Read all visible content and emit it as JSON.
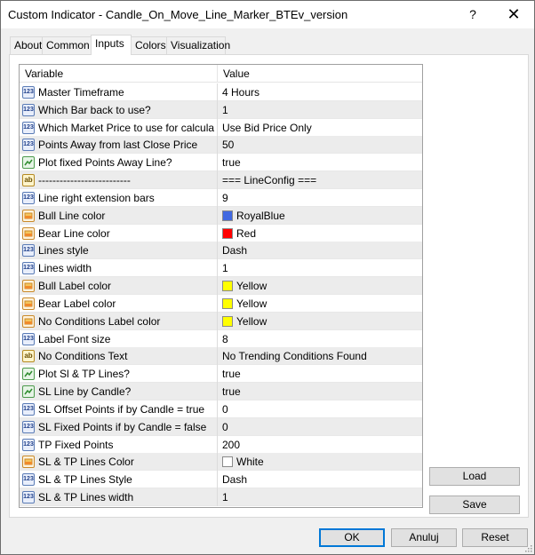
{
  "window": {
    "title": "Custom Indicator - Candle_On_Move_Line_Marker_BTEv_version",
    "help_glyph": "?",
    "close_glyph": "✕"
  },
  "tabs": [
    {
      "label": "About"
    },
    {
      "label": "Common"
    },
    {
      "label": "Inputs",
      "active": true
    },
    {
      "label": "Colors"
    },
    {
      "label": "Visualization"
    }
  ],
  "grid": {
    "col_variable": "Variable",
    "col_value": "Value",
    "rows": [
      {
        "type": "int",
        "icon": "number-icon",
        "icon_text": "123",
        "variable": "Master Timeframe",
        "value": "4 Hours"
      },
      {
        "type": "int",
        "icon": "number-icon",
        "icon_text": "123",
        "variable": "Which Bar back to use?",
        "value": "1"
      },
      {
        "type": "int",
        "icon": "number-icon",
        "icon_text": "123",
        "variable": "Which Market Price to use for calculatio...",
        "value": "Use Bid Price Only"
      },
      {
        "type": "int",
        "icon": "number-icon",
        "icon_text": "123",
        "variable": "Points Away from last Close Price",
        "value": "50"
      },
      {
        "type": "bool",
        "icon": "boolean-icon",
        "icon_text": "",
        "variable": "Plot fixed Points Away Line?",
        "value": "true"
      },
      {
        "type": "text",
        "icon": "string-icon",
        "icon_text": "ab",
        "variable": "--------------------------",
        "value": "=== LineConfig ==="
      },
      {
        "type": "int",
        "icon": "number-icon",
        "icon_text": "123",
        "variable": "Line right extension bars",
        "value": "9"
      },
      {
        "type": "color",
        "icon": "color-icon",
        "icon_text": "",
        "variable": "Bull Line color",
        "value": "RoyalBlue",
        "swatch": "#4169e1"
      },
      {
        "type": "color",
        "icon": "color-icon",
        "icon_text": "",
        "variable": "Bear Line color",
        "value": "Red",
        "swatch": "#ff0000"
      },
      {
        "type": "int",
        "icon": "number-icon",
        "icon_text": "123",
        "variable": "Lines style",
        "value": "Dash"
      },
      {
        "type": "int",
        "icon": "number-icon",
        "icon_text": "123",
        "variable": "Lines width",
        "value": "1"
      },
      {
        "type": "color",
        "icon": "color-icon",
        "icon_text": "",
        "variable": "Bull Label color",
        "value": "Yellow",
        "swatch": "#ffff00"
      },
      {
        "type": "color",
        "icon": "color-icon",
        "icon_text": "",
        "variable": "Bear Label color",
        "value": "Yellow",
        "swatch": "#ffff00"
      },
      {
        "type": "color",
        "icon": "color-icon",
        "icon_text": "",
        "variable": "No Conditions Label color",
        "value": "Yellow",
        "swatch": "#ffff00"
      },
      {
        "type": "int",
        "icon": "number-icon",
        "icon_text": "123",
        "variable": "Label Font size",
        "value": "8"
      },
      {
        "type": "text",
        "icon": "string-icon",
        "icon_text": "ab",
        "variable": "No Conditions Text",
        "value": "No Trending Conditions Found"
      },
      {
        "type": "bool",
        "icon": "boolean-icon",
        "icon_text": "",
        "variable": "Plot Sl & TP Lines?",
        "value": "true"
      },
      {
        "type": "bool",
        "icon": "boolean-icon",
        "icon_text": "",
        "variable": "SL Line by Candle?",
        "value": "true"
      },
      {
        "type": "int",
        "icon": "number-icon",
        "icon_text": "123",
        "variable": "SL Offset Points if by Candle = true",
        "value": "0"
      },
      {
        "type": "int",
        "icon": "number-icon",
        "icon_text": "123",
        "variable": "SL Fixed Points if by Candle = false",
        "value": "0"
      },
      {
        "type": "int",
        "icon": "number-icon",
        "icon_text": "123",
        "variable": "TP Fixed Points",
        "value": "200"
      },
      {
        "type": "color",
        "icon": "color-icon",
        "icon_text": "",
        "variable": "SL & TP Lines Color",
        "value": "White",
        "swatch": "#ffffff"
      },
      {
        "type": "int",
        "icon": "number-icon",
        "icon_text": "123",
        "variable": "SL & TP Lines Style",
        "value": "Dash"
      },
      {
        "type": "int",
        "icon": "number-icon",
        "icon_text": "123",
        "variable": "SL & TP Lines width",
        "value": "1"
      }
    ]
  },
  "side_buttons": {
    "load": "Load",
    "save": "Save"
  },
  "footer": {
    "ok": "OK",
    "cancel": "Anuluj",
    "reset": "Reset"
  }
}
